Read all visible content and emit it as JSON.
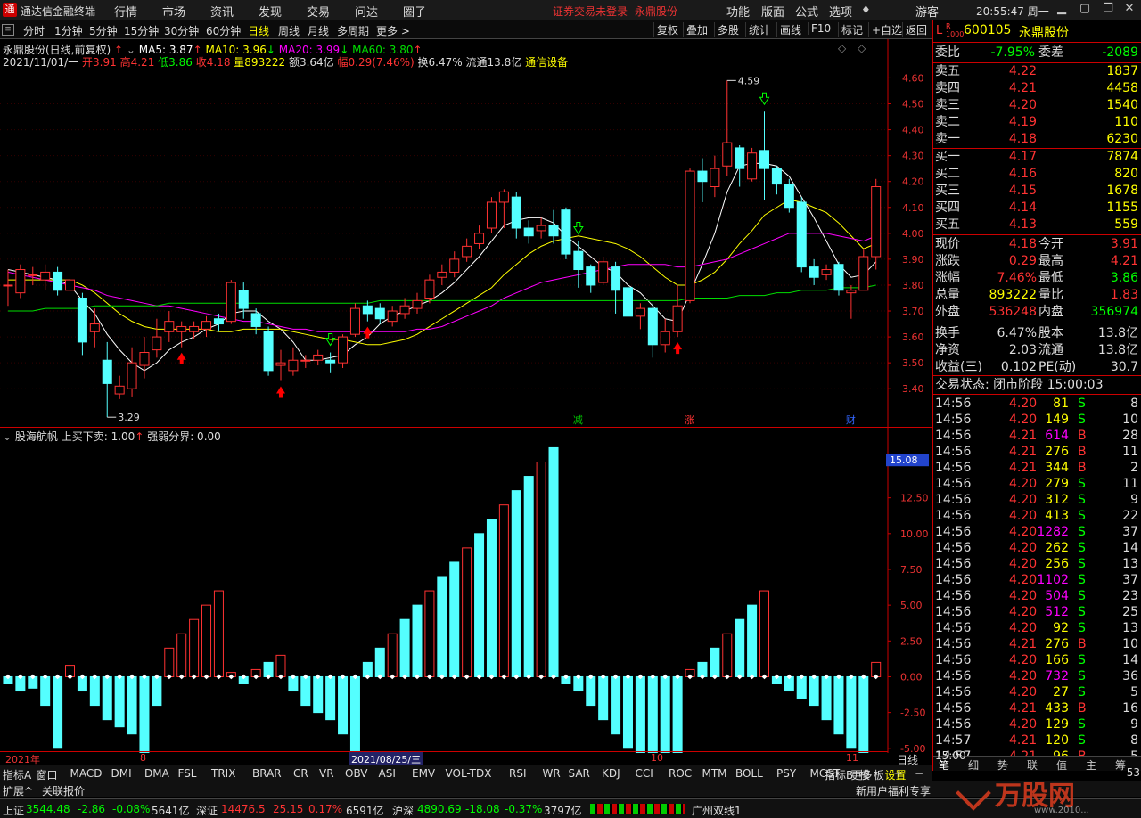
{
  "titlebar": {
    "app_name": "通达信金融终端",
    "menus": [
      "行情",
      "市场",
      "资讯",
      "发现",
      "交易",
      "问达",
      "圈子"
    ],
    "notice": "证券交易未登录",
    "stock": "永鼎股份",
    "right_menus": [
      "功能",
      "版面",
      "公式",
      "选项"
    ],
    "user": "游客",
    "time": "20:55:47 周一"
  },
  "toolbar": {
    "periods": [
      "分时",
      "1分钟",
      "5分钟",
      "15分钟",
      "30分钟",
      "60分钟",
      "日线",
      "周线",
      "月线",
      "多周期",
      "更多 >"
    ],
    "active": "日线",
    "right": [
      "复权",
      "叠加",
      "多股",
      "统计",
      "画线",
      "F10",
      "+自选",
      "返回"
    ]
  },
  "kline_header": {
    "name": "永鼎股份(日线,前复权)",
    "ma5": "MA5: 3.87",
    "ma10": "MA10: 3.96",
    "ma20": "MA20: 3.99",
    "ma60": "MA60: 3.80",
    "info_date": "2021/11/01/一",
    "open": "开3.91",
    "high": "高4.21",
    "low": "低3.86",
    "close": "收4.18",
    "vol": "量893222",
    "amt": "额3.64亿",
    "range": "幅0.29(7.46%)",
    "turnover": "换6.47%",
    "float": "流通13.8亿",
    "industry": "通信设备",
    "max_label": "4.59",
    "min_label": "3.29",
    "markers": [
      "减",
      "涨",
      "财"
    ]
  },
  "chart_data": [
    {
      "type": "candlestick",
      "title": "永鼎股份(日线,前复权)",
      "y_ticks": [
        "4.60",
        "4.50",
        "4.40",
        "4.30",
        "4.20",
        "4.10",
        "4.00",
        "3.90",
        "3.80",
        "3.70",
        "3.60",
        "3.50",
        "3.40"
      ],
      "ylim": [
        3.27,
        4.66
      ],
      "candles": [
        [
          3.8,
          3.8,
          3.86,
          3.72
        ],
        [
          3.77,
          3.86,
          3.88,
          3.75
        ],
        [
          3.84,
          3.84,
          3.87,
          3.8
        ],
        [
          3.82,
          3.85,
          3.88,
          3.78
        ],
        [
          3.85,
          3.78,
          3.87,
          3.76
        ],
        [
          3.78,
          3.82,
          3.85,
          3.74
        ],
        [
          3.75,
          3.58,
          3.77,
          3.53
        ],
        [
          3.62,
          3.65,
          3.71,
          3.56
        ],
        [
          3.51,
          3.42,
          3.58,
          3.29
        ],
        [
          3.38,
          3.41,
          3.45,
          3.36
        ],
        [
          3.4,
          3.5,
          3.56,
          3.37
        ],
        [
          3.49,
          3.54,
          3.6,
          3.44
        ],
        [
          3.55,
          3.6,
          3.67,
          3.52
        ],
        [
          3.62,
          3.66,
          3.7,
          3.58
        ],
        [
          3.62,
          3.64,
          3.66,
          3.56
        ],
        [
          3.62,
          3.64,
          3.66,
          3.59
        ],
        [
          3.63,
          3.66,
          3.68,
          3.6
        ],
        [
          3.67,
          3.65,
          3.69,
          3.62
        ],
        [
          3.66,
          3.81,
          3.82,
          3.65
        ],
        [
          3.78,
          3.71,
          3.81,
          3.67
        ],
        [
          3.69,
          3.64,
          3.71,
          3.61
        ],
        [
          3.62,
          3.47,
          3.64,
          3.45
        ],
        [
          3.49,
          3.5,
          3.55,
          3.43
        ],
        [
          3.47,
          3.51,
          3.56,
          3.45
        ],
        [
          3.51,
          3.51,
          3.53,
          3.48
        ],
        [
          3.51,
          3.53,
          3.55,
          3.49
        ],
        [
          3.51,
          3.5,
          3.54,
          3.46
        ],
        [
          3.5,
          3.6,
          3.61,
          3.48
        ],
        [
          3.61,
          3.71,
          3.73,
          3.6
        ],
        [
          3.72,
          3.69,
          3.74,
          3.66
        ],
        [
          3.71,
          3.67,
          3.73,
          3.65
        ],
        [
          3.66,
          3.7,
          3.72,
          3.64
        ],
        [
          3.69,
          3.72,
          3.75,
          3.67
        ],
        [
          3.71,
          3.74,
          3.77,
          3.69
        ],
        [
          3.75,
          3.82,
          3.84,
          3.73
        ],
        [
          3.83,
          3.85,
          3.88,
          3.8
        ],
        [
          3.85,
          3.9,
          3.93,
          3.83
        ],
        [
          3.91,
          3.95,
          3.98,
          3.89
        ],
        [
          3.96,
          4.0,
          4.03,
          3.94
        ],
        [
          4.02,
          4.12,
          4.14,
          4.0
        ],
        [
          4.12,
          4.16,
          4.17,
          4.02
        ],
        [
          4.14,
          4.02,
          4.16,
          3.98
        ],
        [
          4.02,
          3.99,
          4.05,
          3.96
        ],
        [
          4.01,
          4.03,
          4.06,
          3.98
        ],
        [
          4.03,
          3.99,
          4.09,
          3.96
        ],
        [
          4.09,
          3.92,
          4.1,
          3.9
        ],
        [
          3.93,
          3.86,
          3.97,
          3.79
        ],
        [
          3.87,
          3.8,
          3.88,
          3.77
        ],
        [
          3.81,
          3.89,
          3.91,
          3.8
        ],
        [
          3.87,
          3.78,
          3.89,
          3.69
        ],
        [
          3.79,
          3.68,
          3.81,
          3.61
        ],
        [
          3.68,
          3.71,
          3.73,
          3.63
        ],
        [
          3.71,
          3.57,
          3.73,
          3.52
        ],
        [
          3.57,
          3.62,
          3.67,
          3.54
        ],
        [
          3.62,
          3.72,
          3.8,
          3.6
        ],
        [
          3.74,
          4.24,
          4.25,
          3.73
        ],
        [
          4.24,
          4.2,
          4.29,
          4.12
        ],
        [
          4.18,
          4.25,
          4.3,
          4.14
        ],
        [
          4.26,
          4.35,
          4.59,
          4.22
        ],
        [
          4.33,
          4.25,
          4.34,
          4.18
        ],
        [
          4.21,
          4.31,
          4.33,
          4.2
        ],
        [
          4.32,
          4.25,
          4.47,
          4.13
        ],
        [
          4.25,
          4.19,
          4.26,
          4.15
        ],
        [
          4.19,
          4.1,
          4.21,
          4.08
        ],
        [
          4.12,
          3.87,
          4.14,
          3.85
        ],
        [
          3.87,
          3.83,
          3.9,
          3.8
        ],
        [
          3.84,
          3.86,
          3.88,
          3.82
        ],
        [
          3.88,
          3.78,
          3.89,
          3.76
        ],
        [
          3.77,
          3.78,
          3.8,
          3.67
        ],
        [
          3.78,
          3.91,
          3.94,
          3.78
        ],
        [
          3.91,
          4.18,
          4.21,
          3.86
        ]
      ],
      "ma_lines": [
        {
          "name": "MA5",
          "color": "#ffffff",
          "values": [
            3.86,
            3.85,
            3.84,
            3.83,
            3.82,
            3.8,
            3.74,
            3.69,
            3.61,
            3.55,
            3.5,
            3.47,
            3.5,
            3.55,
            3.58,
            3.6,
            3.63,
            3.65,
            3.69,
            3.7,
            3.7,
            3.66,
            3.63,
            3.58,
            3.51,
            3.51,
            3.52,
            3.53,
            3.57,
            3.6,
            3.65,
            3.68,
            3.7,
            3.72,
            3.74,
            3.77,
            3.81,
            3.86,
            3.91,
            3.97,
            4.03,
            4.05,
            4.06,
            4.06,
            4.04,
            3.99,
            3.95,
            3.91,
            3.87,
            3.85,
            3.8,
            3.77,
            3.72,
            3.67,
            3.66,
            3.77,
            3.88,
            4.0,
            4.16,
            4.26,
            4.27,
            4.27,
            4.26,
            4.22,
            4.14,
            4.06,
            3.97,
            3.88,
            3.83,
            3.84,
            3.89
          ]
        },
        {
          "name": "MA10",
          "color": "#ffff00",
          "values": [
            3.82,
            3.82,
            3.82,
            3.82,
            3.82,
            3.82,
            3.8,
            3.77,
            3.73,
            3.69,
            3.66,
            3.64,
            3.63,
            3.63,
            3.63,
            3.63,
            3.63,
            3.62,
            3.62,
            3.63,
            3.63,
            3.63,
            3.63,
            3.62,
            3.61,
            3.6,
            3.59,
            3.59,
            3.58,
            3.57,
            3.57,
            3.58,
            3.59,
            3.61,
            3.64,
            3.67,
            3.7,
            3.73,
            3.76,
            3.79,
            3.84,
            3.88,
            3.92,
            3.95,
            3.97,
            3.98,
            3.99,
            3.98,
            3.97,
            3.96,
            3.94,
            3.91,
            3.87,
            3.83,
            3.8,
            3.8,
            3.82,
            3.85,
            3.9,
            3.96,
            4.01,
            4.07,
            4.1,
            4.13,
            4.12,
            4.1,
            4.08,
            4.04,
            3.99,
            3.94,
            3.96
          ]
        },
        {
          "name": "MA20",
          "color": "#ff00ff",
          "values": [
            3.85,
            3.84,
            3.83,
            3.82,
            3.81,
            3.8,
            3.79,
            3.78,
            3.76,
            3.75,
            3.74,
            3.73,
            3.72,
            3.72,
            3.71,
            3.7,
            3.69,
            3.68,
            3.67,
            3.66,
            3.66,
            3.65,
            3.64,
            3.63,
            3.63,
            3.62,
            3.62,
            3.62,
            3.62,
            3.62,
            3.62,
            3.62,
            3.62,
            3.63,
            3.63,
            3.64,
            3.66,
            3.68,
            3.7,
            3.72,
            3.75,
            3.77,
            3.79,
            3.81,
            3.82,
            3.83,
            3.84,
            3.85,
            3.86,
            3.87,
            3.88,
            3.88,
            3.88,
            3.88,
            3.87,
            3.87,
            3.88,
            3.89,
            3.9,
            3.92,
            3.94,
            3.96,
            3.98,
            4.0,
            4.0,
            4.0,
            4.0,
            3.99,
            3.98,
            3.97,
            3.99
          ]
        },
        {
          "name": "MA60",
          "color": "#00dd00",
          "values": [
            3.7,
            3.7,
            3.7,
            3.71,
            3.71,
            3.71,
            3.71,
            3.72,
            3.72,
            3.72,
            3.72,
            3.72,
            3.72,
            3.73,
            3.73,
            3.73,
            3.73,
            3.73,
            3.73,
            3.73,
            3.73,
            3.73,
            3.73,
            3.73,
            3.73,
            3.73,
            3.73,
            3.73,
            3.73,
            3.73,
            3.74,
            3.74,
            3.74,
            3.74,
            3.74,
            3.74,
            3.74,
            3.74,
            3.74,
            3.74,
            3.74,
            3.74,
            3.74,
            3.74,
            3.74,
            3.74,
            3.74,
            3.74,
            3.74,
            3.74,
            3.74,
            3.74,
            3.74,
            3.74,
            3.74,
            3.75,
            3.75,
            3.75,
            3.75,
            3.76,
            3.76,
            3.76,
            3.77,
            3.77,
            3.78,
            3.78,
            3.78,
            3.79,
            3.79,
            3.79,
            3.8
          ]
        }
      ]
    },
    {
      "type": "bar",
      "title": "股海航帆",
      "y_ticks": [
        "15.00",
        "12.50",
        "10.00",
        "7.50",
        "5.00",
        "2.50",
        "0.00",
        "-2.50",
        "-5.00"
      ],
      "ylim": [
        -5.2,
        16.4
      ],
      "current": "15.08",
      "values": [
        -0.5,
        -1,
        -0.8,
        -2,
        -5,
        0.8,
        -1,
        -2,
        -3,
        -3.5,
        -4,
        -5.5,
        -2,
        2,
        3,
        4,
        5,
        6,
        0.3,
        -0.5,
        0.5,
        1,
        1.5,
        -1,
        -2,
        -2.5,
        -3,
        -4,
        -6,
        1,
        2,
        3,
        4,
        5,
        6,
        7,
        8,
        9,
        10,
        11,
        12,
        13,
        14,
        15,
        16,
        -0.5,
        -1,
        -2,
        -3,
        -4,
        -5,
        -6,
        -7,
        -8,
        -10,
        0.5,
        1,
        2,
        3,
        4,
        5,
        6,
        -0.5,
        -1,
        -1.5,
        -2,
        -3,
        -4,
        -5,
        -8,
        1
      ]
    }
  ],
  "indicator_header": {
    "name": "股海航帆",
    "buy_sell": "上买下卖: 1.00",
    "strong": "强弱分界: 0.00"
  },
  "date_axis": [
    "2021年",
    "8",
    "2021/08/25/三",
    "10",
    "11"
  ],
  "right_panel": {
    "header": {
      "code": "600105",
      "name": "永鼎股份",
      "tag": "L"
    },
    "weibi": {
      "label": "委比",
      "value": "-7.95%",
      "label2": "委差",
      "value2": "-2089"
    },
    "asks": [
      [
        "卖五",
        "4.22",
        "1837"
      ],
      [
        "卖四",
        "4.21",
        "4458"
      ],
      [
        "卖三",
        "4.20",
        "1540"
      ],
      [
        "卖二",
        "4.19",
        "110"
      ],
      [
        "卖一",
        "4.18",
        "6230"
      ]
    ],
    "bids": [
      [
        "买一",
        "4.17",
        "7874"
      ],
      [
        "买二",
        "4.16",
        "820"
      ],
      [
        "买三",
        "4.15",
        "1678"
      ],
      [
        "买四",
        "4.14",
        "1155"
      ],
      [
        "买五",
        "4.13",
        "559"
      ]
    ],
    "stats": [
      [
        "现价",
        "4.18",
        "今开",
        "3.91"
      ],
      [
        "涨跌",
        "0.29",
        "最高",
        "4.21"
      ],
      [
        "涨幅",
        "7.46%",
        "最低",
        "3.86"
      ],
      [
        "总量",
        "893222",
        "量比",
        "1.83"
      ],
      [
        "外盘",
        "536248",
        "内盘",
        "356974"
      ],
      [
        "换手",
        "6.47%",
        "股本",
        "13.8亿"
      ],
      [
        "净资",
        "2.03",
        "流通",
        "13.8亿"
      ],
      [
        "收益(三)",
        "0.102",
        "PE(动)",
        "30.7"
      ]
    ],
    "trade_state": "交易状态: 闭市阶段 15:00:03",
    "ticks": [
      [
        "14:56",
        "4.20",
        "81",
        "S",
        "8"
      ],
      [
        "14:56",
        "4.20",
        "149",
        "S",
        "10"
      ],
      [
        "14:56",
        "4.21",
        "614",
        "B",
        "28"
      ],
      [
        "14:56",
        "4.21",
        "276",
        "B",
        "11"
      ],
      [
        "14:56",
        "4.21",
        "344",
        "B",
        "2"
      ],
      [
        "14:56",
        "4.20",
        "279",
        "S",
        "11"
      ],
      [
        "14:56",
        "4.20",
        "312",
        "S",
        "9"
      ],
      [
        "14:56",
        "4.20",
        "413",
        "S",
        "22"
      ],
      [
        "14:56",
        "4.20",
        "1282",
        "S",
        "37"
      ],
      [
        "14:56",
        "4.20",
        "262",
        "S",
        "14"
      ],
      [
        "14:56",
        "4.20",
        "256",
        "S",
        "13"
      ],
      [
        "14:56",
        "4.20",
        "1102",
        "S",
        "37"
      ],
      [
        "14:56",
        "4.20",
        "504",
        "S",
        "23"
      ],
      [
        "14:56",
        "4.20",
        "512",
        "S",
        "25"
      ],
      [
        "14:56",
        "4.20",
        "92",
        "S",
        "13"
      ],
      [
        "14:56",
        "4.21",
        "276",
        "B",
        "10"
      ],
      [
        "14:56",
        "4.20",
        "166",
        "S",
        "14"
      ],
      [
        "14:56",
        "4.20",
        "732",
        "S",
        "36"
      ],
      [
        "14:56",
        "4.20",
        "27",
        "S",
        "5"
      ],
      [
        "14:56",
        "4.21",
        "433",
        "B",
        "16"
      ],
      [
        "14:56",
        "4.20",
        "129",
        "S",
        "9"
      ],
      [
        "14:57",
        "4.21",
        "120",
        "S",
        "8"
      ],
      [
        "14:57",
        "4.21",
        "96",
        "B",
        "5"
      ]
    ],
    "bottom_tabs": [
      "笔",
      "细",
      "势",
      "联",
      "值",
      "主",
      "筹"
    ],
    "time_axis": "15:00",
    "axis_53": "53"
  },
  "tabs": [
    "指标A",
    "窗口",
    "MACD",
    "DMI",
    "DMA",
    "FSL",
    "TRIX",
    "BRAR",
    "CR",
    "VR",
    "OBV",
    "ASI",
    "EMV",
    "VOL-TDX",
    "RSI",
    "WR",
    "SAR",
    "KDJ",
    "CCI",
    "ROC",
    "MTM",
    "BOLL",
    "PSY",
    "MCST",
    "更多",
    "设置"
  ],
  "tabs_right": [
    "指标B",
    "模 板",
    "+",
    "−"
  ],
  "tabs_period": "日线",
  "sub_tabs": [
    "扩展^",
    "关联报价"
  ],
  "promo": "新用户福利专享",
  "status": {
    "items": [
      {
        "name": "上证",
        "price": "3544.48",
        "chg": "-2.86",
        "pct": "-0.08%",
        "amt": "5641亿"
      },
      {
        "name": "深证",
        "price": "14476.5",
        "chg": "25.15",
        "pct": "0.17%",
        "amt": "6591亿"
      },
      {
        "name": "沪深",
        "price": "4890.69",
        "chg": "-18.08",
        "pct": "-0.37%",
        "amt": "3797亿"
      }
    ],
    "line": "广州双线1"
  },
  "watermark": {
    "text": "万股网",
    "url": "www.2010..."
  }
}
